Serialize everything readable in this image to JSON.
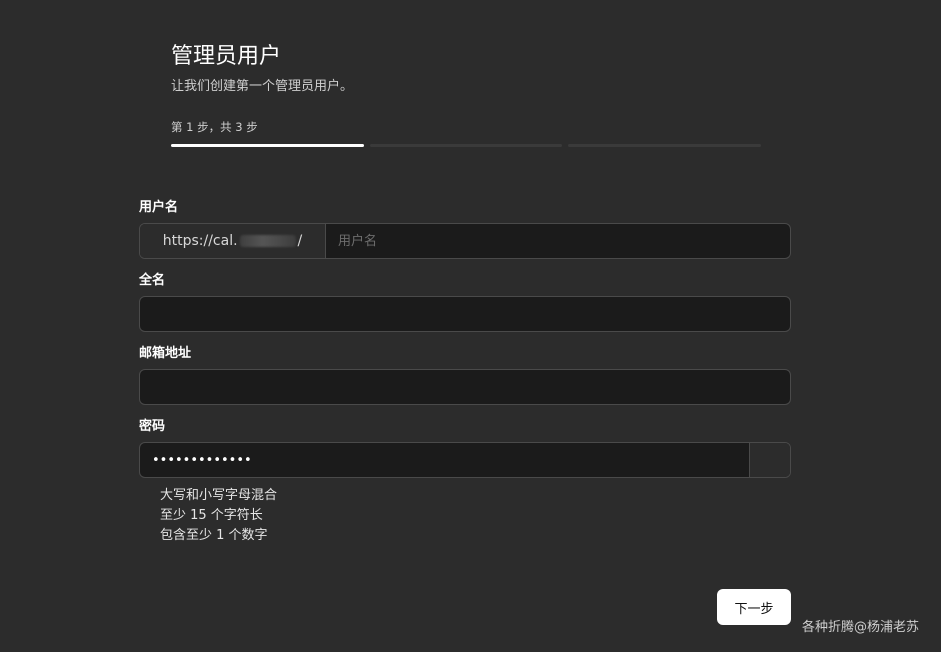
{
  "header": {
    "title": "管理员用户",
    "subtitle": "让我们创建第一个管理员用户。",
    "step_text": "第 1 步，共 3 步",
    "progress": {
      "current": 1,
      "total": 3
    }
  },
  "form": {
    "username": {
      "label": "用户名",
      "prefix_start": "https://cal.",
      "prefix_end": "/",
      "placeholder": "用户名",
      "value": ""
    },
    "fullname": {
      "label": "全名",
      "value": ""
    },
    "email": {
      "label": "邮箱地址",
      "value": ""
    },
    "password": {
      "label": "密码",
      "value": "•••••••••••••"
    },
    "password_rules": [
      "大写和小写字母混合",
      "至少 15 个字符长",
      "包含至少 1 个数字"
    ]
  },
  "actions": {
    "next_label": "下一步"
  },
  "watermark": "各种折腾@杨浦老苏"
}
